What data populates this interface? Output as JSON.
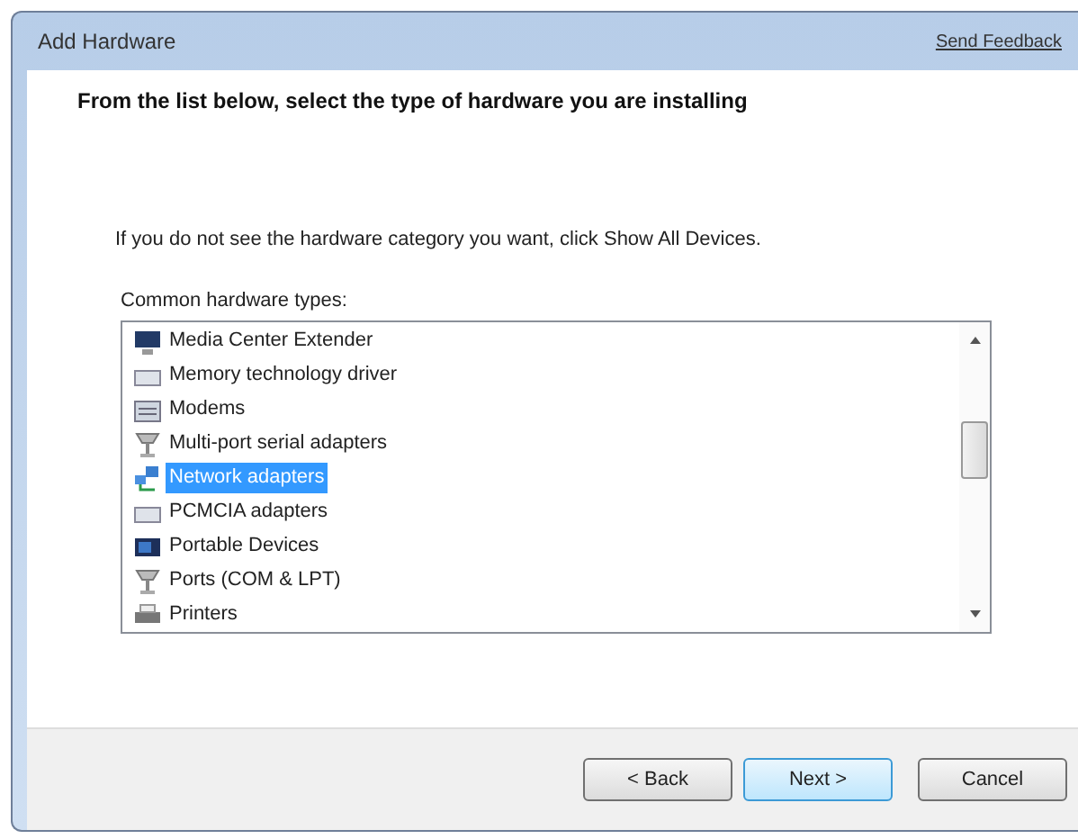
{
  "window": {
    "title": "Add Hardware",
    "feedback_link": "Send Feedback"
  },
  "heading": "From the list below, select the type of hardware you are installing",
  "instruction": "If you do not see the hardware category you want, click Show All Devices.",
  "list_label": "Common hardware types:",
  "items": [
    {
      "label": "Media Center Extender",
      "kind": "monitor",
      "selected": false
    },
    {
      "label": "Memory technology driver",
      "kind": "card",
      "selected": false
    },
    {
      "label": "Modems",
      "kind": "modem",
      "selected": false
    },
    {
      "label": "Multi-port serial adapters",
      "kind": "port",
      "selected": false
    },
    {
      "label": "Network adapters",
      "kind": "network",
      "selected": true
    },
    {
      "label": "PCMCIA adapters",
      "kind": "card",
      "selected": false
    },
    {
      "label": "Portable Devices",
      "kind": "device",
      "selected": false
    },
    {
      "label": "Ports (COM & LPT)",
      "kind": "port",
      "selected": false
    },
    {
      "label": "Printers",
      "kind": "printer",
      "selected": false
    }
  ],
  "buttons": [
    {
      "label": "< Back",
      "kind": "normal"
    },
    {
      "label": "Next >",
      "kind": "default"
    },
    {
      "label": "Cancel",
      "kind": "normal"
    }
  ]
}
